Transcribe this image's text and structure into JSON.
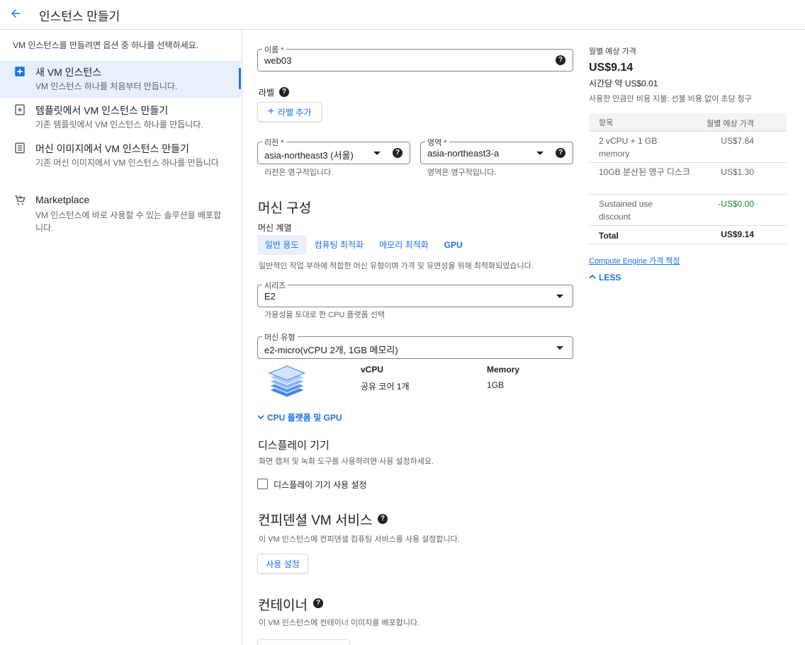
{
  "header": {
    "title": "인스턴스 만들기"
  },
  "left": {
    "intro": "VM 인스턴스를 만들려면 옵션 중 하나를 선택하세요.",
    "options": [
      {
        "title": "새 VM 인스턴스",
        "desc": "VM 인스턴스 하나를 처음부터 만듭니다.",
        "icon": "add-box-icon"
      },
      {
        "title": "템플릿에서 VM 인스턴스 만들기",
        "desc": "기존 템플릿에서 VM 인스턴스 하나를 만듭니다.",
        "icon": "template-icon"
      },
      {
        "title": "머신 이미지에서 VM 인스턴스 만들기",
        "desc": "기존 머신 이미지에서 VM 인스턴스 하나를 만듭니다",
        "icon": "machine-image-icon"
      },
      {
        "title": "Marketplace",
        "desc": "VM 인스턴스에 바로 사용할 수 있는 솔루션을 배포합니다.",
        "icon": "marketplace-cart-icon"
      }
    ]
  },
  "form": {
    "name": {
      "label": "이름 *",
      "value": "web03"
    },
    "labels": {
      "title": "라벨",
      "add_button": "라벨 추가"
    },
    "region": {
      "label": "리전 *",
      "value": "asia-northeast3 (서울)",
      "hint": "리전은 영구적입니다."
    },
    "zone": {
      "label": "영역 *",
      "value": "asia-northeast3-a",
      "hint": "영역은 영구적입니다."
    },
    "machine": {
      "title": "머신 구성",
      "family_label": "머신 계열",
      "tabs": [
        "일반 용도",
        "컴퓨팅 최적화",
        "메모리 최적화",
        "GPU"
      ],
      "family_hint": "일반적인 작업 부하에 적합한 머신 유형이며 가격 및 유연성을 위해 최적화되었습니다.",
      "series": {
        "label": "시리즈",
        "value": "E2",
        "hint": "가용성을 토대로 한 CPU 플랫폼 선택"
      },
      "type": {
        "label": "머신 유형",
        "value": "e2-micro(vCPU 2개, 1GB 메모리)"
      },
      "spec": {
        "vcpu_header": "vCPU",
        "vcpu_value": "공유 코어 1개",
        "memory_header": "Memory",
        "memory_value": "1GB"
      },
      "cpu_gpu_toggle": "CPU 플랫폼 및 GPU"
    },
    "display": {
      "title": "디스플레이 기기",
      "hint": "화면 캡처 및 녹화 도구를 사용하려면 사용 설정하세요.",
      "checkbox": "디스플레이 기기 사용 설정"
    },
    "confidential": {
      "title": "컨피덴셜 VM 서비스",
      "hint": "이 VM 인스턴스에 컨피덴셜 컴퓨팅 서비스를 사용 설정합니다.",
      "button": "사용 설정"
    },
    "container": {
      "title": "컨테이너",
      "hint": "이 VM 인스턴스에 컨테이너 이미지를 배포합니다."
    }
  },
  "pricing": {
    "title": "월별 예상 가격",
    "monthly": "US$9.14",
    "hourly": "시간당 약 US$0.01",
    "note": "사용한 만큼만 비용 지불: 선불 비용 없이 초당 청구",
    "table_headers": [
      "항목",
      "월별 예상 가격"
    ],
    "rows": [
      {
        "item": "2 vCPU + 1 GB memory",
        "price": "US$7.84"
      },
      {
        "item": "10GB 분산된 영구 디스크",
        "price": "US$1.30"
      },
      {
        "item": "Sustained use discount",
        "price": "-US$0.00"
      },
      {
        "item": "Total",
        "price": "US$9.14"
      }
    ],
    "link": "Compute Engine 가격 책정",
    "less": "LESS"
  },
  "colors": {
    "accent": "#1a73e8",
    "active_bg": "#e8f0fe",
    "discount": "#188038"
  }
}
